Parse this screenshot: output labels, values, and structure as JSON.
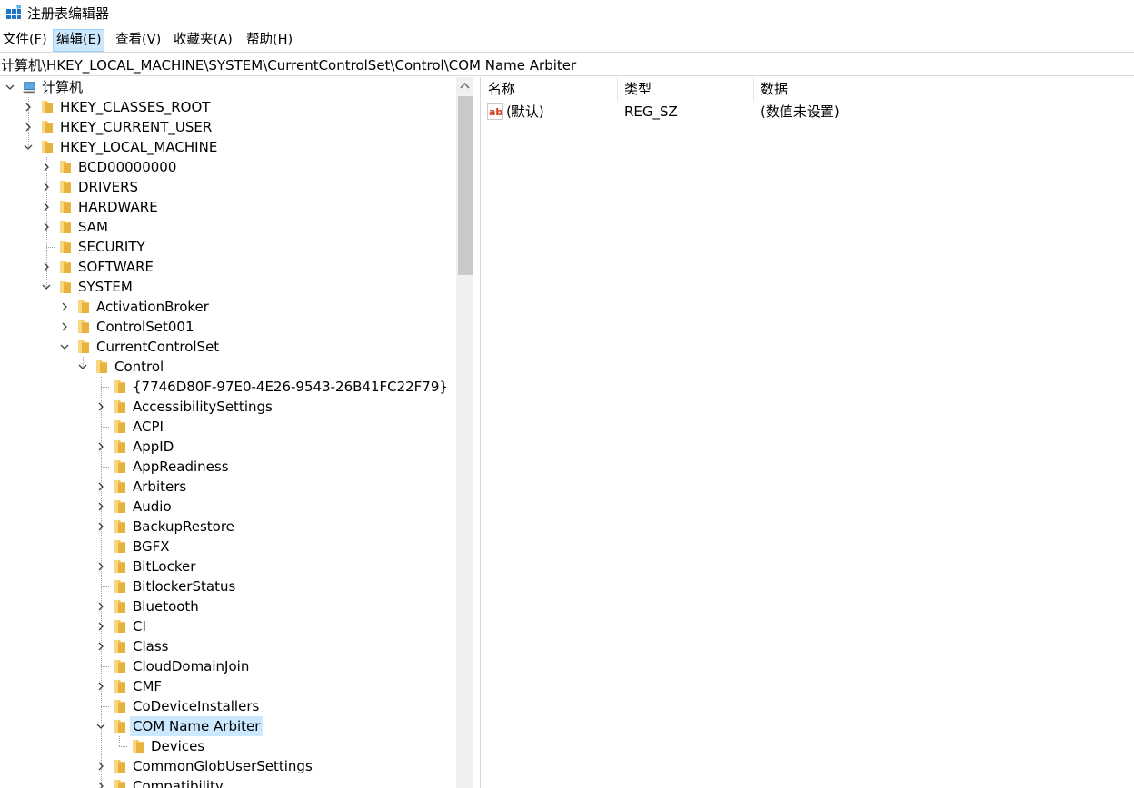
{
  "window": {
    "title": "注册表编辑器"
  },
  "menu": [
    {
      "label": "文件(F)"
    },
    {
      "label": "编辑(E)",
      "active": true
    },
    {
      "label": "查看(V)"
    },
    {
      "label": "收藏夹(A)"
    },
    {
      "label": "帮助(H)"
    }
  ],
  "address": {
    "path": "计算机\\HKEY_LOCAL_MACHINE\\SYSTEM\\CurrentControlSet\\Control\\COM Name Arbiter"
  },
  "tree": [
    {
      "label": "计算机",
      "level": 0,
      "state": "expanded",
      "icon": "computer-icon"
    },
    {
      "label": "HKEY_CLASSES_ROOT",
      "level": 1,
      "state": "collapsed"
    },
    {
      "label": "HKEY_CURRENT_USER",
      "level": 1,
      "state": "collapsed"
    },
    {
      "label": "HKEY_LOCAL_MACHINE",
      "level": 1,
      "state": "expanded"
    },
    {
      "label": "BCD00000000",
      "level": 2,
      "state": "collapsed"
    },
    {
      "label": "DRIVERS",
      "level": 2,
      "state": "collapsed"
    },
    {
      "label": "HARDWARE",
      "level": 2,
      "state": "collapsed"
    },
    {
      "label": "SAM",
      "level": 2,
      "state": "collapsed"
    },
    {
      "label": "SECURITY",
      "level": 2,
      "state": "leaf"
    },
    {
      "label": "SOFTWARE",
      "level": 2,
      "state": "collapsed"
    },
    {
      "label": "SYSTEM",
      "level": 2,
      "state": "expanded"
    },
    {
      "label": "ActivationBroker",
      "level": 3,
      "state": "collapsed"
    },
    {
      "label": "ControlSet001",
      "level": 3,
      "state": "collapsed"
    },
    {
      "label": "CurrentControlSet",
      "level": 3,
      "state": "expanded"
    },
    {
      "label": "Control",
      "level": 4,
      "state": "expanded"
    },
    {
      "label": "{7746D80F-97E0-4E26-9543-26B41FC22F79}",
      "level": 5,
      "state": "leaf"
    },
    {
      "label": "AccessibilitySettings",
      "level": 5,
      "state": "collapsed"
    },
    {
      "label": "ACPI",
      "level": 5,
      "state": "leaf"
    },
    {
      "label": "AppID",
      "level": 5,
      "state": "collapsed"
    },
    {
      "label": "AppReadiness",
      "level": 5,
      "state": "leaf"
    },
    {
      "label": "Arbiters",
      "level": 5,
      "state": "collapsed"
    },
    {
      "label": "Audio",
      "level": 5,
      "state": "collapsed"
    },
    {
      "label": "BackupRestore",
      "level": 5,
      "state": "collapsed"
    },
    {
      "label": "BGFX",
      "level": 5,
      "state": "leaf"
    },
    {
      "label": "BitLocker",
      "level": 5,
      "state": "collapsed"
    },
    {
      "label": "BitlockerStatus",
      "level": 5,
      "state": "leaf"
    },
    {
      "label": "Bluetooth",
      "level": 5,
      "state": "collapsed"
    },
    {
      "label": "CI",
      "level": 5,
      "state": "collapsed"
    },
    {
      "label": "Class",
      "level": 5,
      "state": "collapsed"
    },
    {
      "label": "CloudDomainJoin",
      "level": 5,
      "state": "leaf"
    },
    {
      "label": "CMF",
      "level": 5,
      "state": "collapsed"
    },
    {
      "label": "CoDeviceInstallers",
      "level": 5,
      "state": "leaf"
    },
    {
      "label": "COM Name Arbiter",
      "level": 5,
      "state": "expanded",
      "selected": true
    },
    {
      "label": "Devices",
      "level": 6,
      "state": "leaf"
    },
    {
      "label": "CommonGlobUserSettings",
      "level": 5,
      "state": "collapsed"
    },
    {
      "label": "Compatibility",
      "level": 5,
      "state": "collapsed"
    }
  ],
  "list": {
    "columns": [
      {
        "label": "名称"
      },
      {
        "label": "类型"
      },
      {
        "label": "数据"
      }
    ],
    "rows": [
      {
        "name": "(默认)",
        "type": "REG_SZ",
        "data": "(数值未设置)",
        "icon": "string-value-icon"
      }
    ]
  },
  "colors": {
    "selection": "#cce8ff",
    "selection_border": "#99d1ff",
    "folder": "#f5c65a",
    "scroll_thumb": "#c9c9c9"
  }
}
